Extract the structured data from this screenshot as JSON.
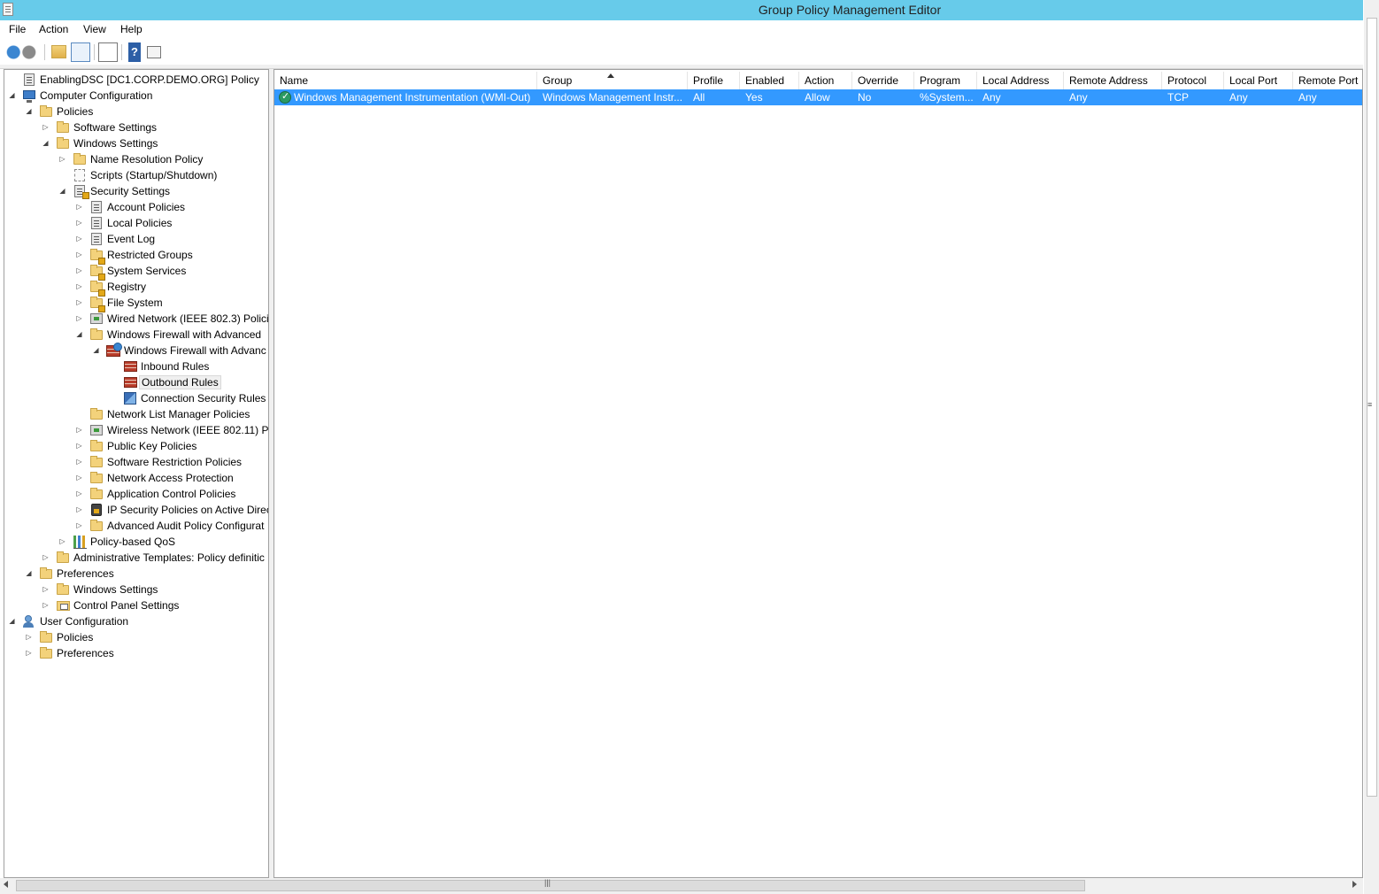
{
  "window": {
    "title": "Group Policy Management Editor"
  },
  "menu": [
    "File",
    "Action",
    "View",
    "Help"
  ],
  "toolbar": {
    "buttons": [
      "back-icon",
      "forward-icon",
      "up-folder-icon",
      "show-hide-tree-icon",
      "export-list-icon",
      "help-icon",
      "properties-icon"
    ]
  },
  "tree": [
    {
      "label": "EnablingDSC [DC1.CORP.DEMO.ORG] Policy",
      "level": 0,
      "expander": "",
      "icon": "policy-doc"
    },
    {
      "label": "Computer Configuration",
      "level": 0,
      "expander": "open",
      "icon": "computer"
    },
    {
      "label": "Policies",
      "level": 1,
      "expander": "open",
      "icon": "folder"
    },
    {
      "label": "Software Settings",
      "level": 2,
      "expander": "closed",
      "icon": "folder"
    },
    {
      "label": "Windows Settings",
      "level": 2,
      "expander": "open",
      "icon": "folder"
    },
    {
      "label": "Name Resolution Policy",
      "level": 3,
      "expander": "closed",
      "icon": "folder"
    },
    {
      "label": "Scripts (Startup/Shutdown)",
      "level": 3,
      "expander": "",
      "icon": "scripts"
    },
    {
      "label": "Security Settings",
      "level": 3,
      "expander": "open",
      "icon": "lock-doc"
    },
    {
      "label": "Account Policies",
      "level": 4,
      "expander": "closed",
      "icon": "policy-doc"
    },
    {
      "label": "Local Policies",
      "level": 4,
      "expander": "closed",
      "icon": "policy-doc"
    },
    {
      "label": "Event Log",
      "level": 4,
      "expander": "closed",
      "icon": "policy-doc"
    },
    {
      "label": "Restricted Groups",
      "level": 4,
      "expander": "closed",
      "icon": "lock-folder"
    },
    {
      "label": "System Services",
      "level": 4,
      "expander": "closed",
      "icon": "lock-folder"
    },
    {
      "label": "Registry",
      "level": 4,
      "expander": "closed",
      "icon": "lock-folder"
    },
    {
      "label": "File System",
      "level": 4,
      "expander": "closed",
      "icon": "lock-folder"
    },
    {
      "label": "Wired Network (IEEE 802.3) Policie",
      "level": 4,
      "expander": "closed",
      "icon": "net"
    },
    {
      "label": "Windows Firewall with Advanced",
      "level": 4,
      "expander": "open",
      "icon": "folder"
    },
    {
      "label": "Windows Firewall with Advanc",
      "level": 5,
      "expander": "open",
      "icon": "fw-globe"
    },
    {
      "label": "Inbound Rules",
      "level": 6,
      "expander": "",
      "icon": "fw-red"
    },
    {
      "label": "Outbound Rules",
      "level": 6,
      "expander": "",
      "icon": "fw-red",
      "selected": true
    },
    {
      "label": "Connection Security Rules",
      "level": 6,
      "expander": "",
      "icon": "conn"
    },
    {
      "label": "Network List Manager Policies",
      "level": 4,
      "expander": "",
      "icon": "folder"
    },
    {
      "label": "Wireless Network (IEEE 802.11) Pol",
      "level": 4,
      "expander": "closed",
      "icon": "net"
    },
    {
      "label": "Public Key Policies",
      "level": 4,
      "expander": "closed",
      "icon": "folder"
    },
    {
      "label": "Software Restriction Policies",
      "level": 4,
      "expander": "closed",
      "icon": "folder"
    },
    {
      "label": "Network Access Protection",
      "level": 4,
      "expander": "closed",
      "icon": "folder"
    },
    {
      "label": "Application Control Policies",
      "level": 4,
      "expander": "closed",
      "icon": "folder"
    },
    {
      "label": "IP Security Policies on Active Direc",
      "level": 4,
      "expander": "closed",
      "icon": "ipsec"
    },
    {
      "label": "Advanced Audit Policy Configurat",
      "level": 4,
      "expander": "closed",
      "icon": "folder"
    },
    {
      "label": "Policy-based QoS",
      "level": 3,
      "expander": "closed",
      "icon": "chart"
    },
    {
      "label": "Administrative Templates: Policy definitic",
      "level": 2,
      "expander": "closed",
      "icon": "folder"
    },
    {
      "label": "Preferences",
      "level": 1,
      "expander": "open",
      "icon": "folder"
    },
    {
      "label": "Windows Settings",
      "level": 2,
      "expander": "closed",
      "icon": "folder"
    },
    {
      "label": "Control Panel Settings",
      "level": 2,
      "expander": "closed",
      "icon": "panel"
    },
    {
      "label": "User Configuration",
      "level": 0,
      "expander": "open",
      "icon": "users"
    },
    {
      "label": "Policies",
      "level": 1,
      "expander": "closed",
      "icon": "folder"
    },
    {
      "label": "Preferences",
      "level": 1,
      "expander": "closed",
      "icon": "folder"
    }
  ],
  "list": {
    "columns": [
      "Name",
      "Group",
      "Profile",
      "Enabled",
      "Action",
      "Override",
      "Program",
      "Local Address",
      "Remote Address",
      "Protocol",
      "Local Port",
      "Remote Port"
    ],
    "sort_column": "Group",
    "rows": [
      [
        "Windows Management Instrumentation (WMI-Out)",
        "Windows Management Instr...",
        "All",
        "Yes",
        "Allow",
        "No",
        "%System...",
        "Any",
        "Any",
        "TCP",
        "Any",
        "Any"
      ]
    ],
    "selection_color": "#3399ff"
  },
  "colors": {
    "titlebar": "#67cbea"
  }
}
